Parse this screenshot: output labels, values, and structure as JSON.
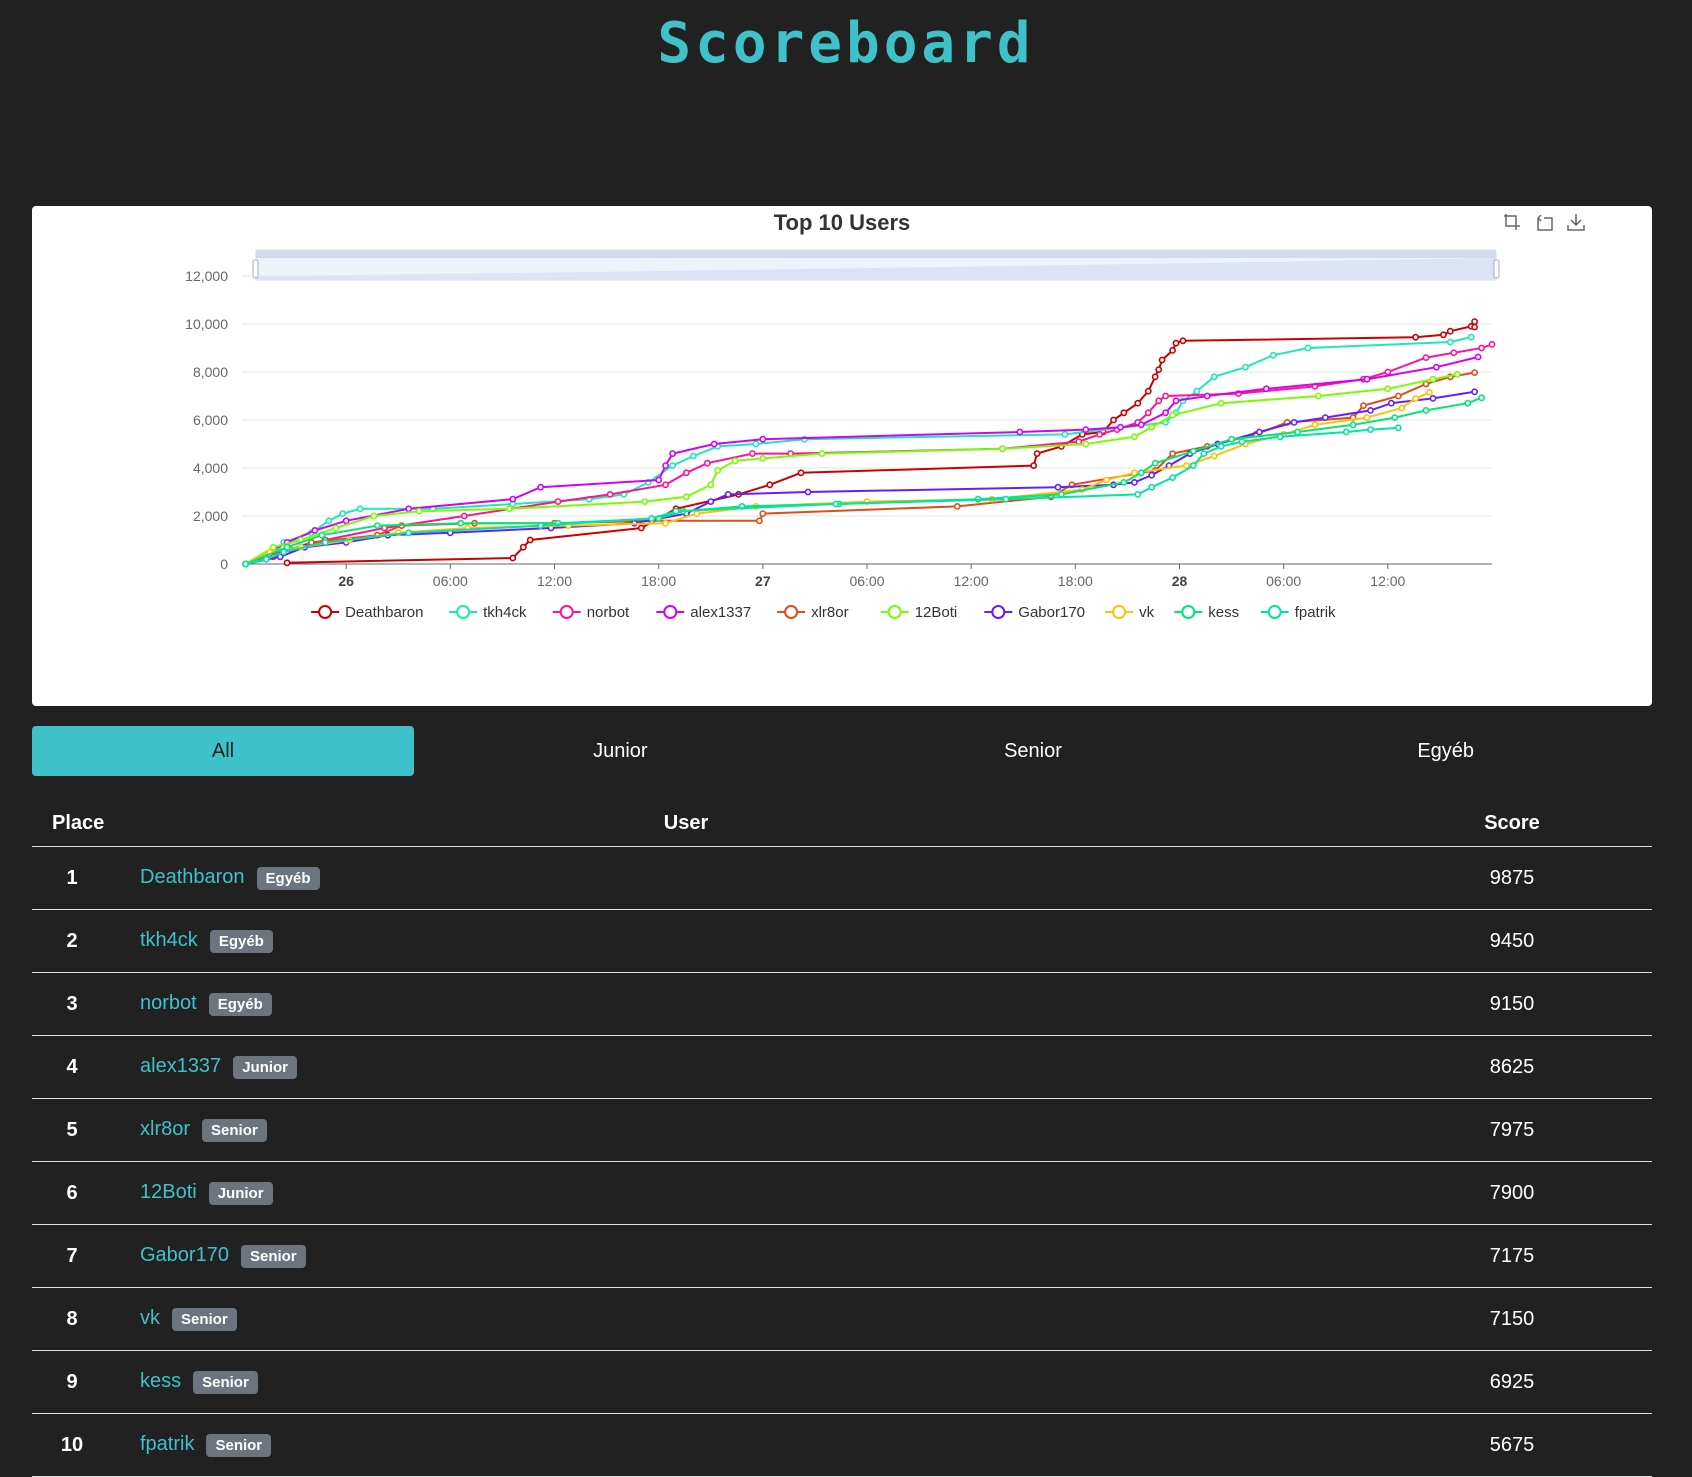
{
  "header": {
    "title": "Scoreboard"
  },
  "toolbox": {
    "zoom_icon": "zoom-icon",
    "restore_icon": "restore-icon",
    "download_icon": "download-icon"
  },
  "tabs": [
    {
      "label": "All",
      "active": true
    },
    {
      "label": "Junior",
      "active": false
    },
    {
      "label": "Senior",
      "active": false
    },
    {
      "label": "Egyéb",
      "active": false
    }
  ],
  "table": {
    "headers": {
      "place": "Place",
      "user": "User",
      "score": "Score"
    },
    "rows": [
      {
        "place": "1",
        "user": "Deathbaron",
        "badge": "Egyéb",
        "score": "9875"
      },
      {
        "place": "2",
        "user": "tkh4ck",
        "badge": "Egyéb",
        "score": "9450"
      },
      {
        "place": "3",
        "user": "norbot",
        "badge": "Egyéb",
        "score": "9150"
      },
      {
        "place": "4",
        "user": "alex1337",
        "badge": "Junior",
        "score": "8625"
      },
      {
        "place": "5",
        "user": "xlr8or",
        "badge": "Senior",
        "score": "7975"
      },
      {
        "place": "6",
        "user": "12Boti",
        "badge": "Junior",
        "score": "7900"
      },
      {
        "place": "7",
        "user": "Gabor170",
        "badge": "Senior",
        "score": "7175"
      },
      {
        "place": "8",
        "user": "vk",
        "badge": "Senior",
        "score": "7150"
      },
      {
        "place": "9",
        "user": "kess",
        "badge": "Senior",
        "score": "6925"
      },
      {
        "place": "10",
        "user": "fpatrik",
        "badge": "Senior",
        "score": "5675"
      }
    ]
  },
  "chart_data": {
    "type": "line",
    "title": "Top 10 Users",
    "ylim": [
      0,
      12000
    ],
    "yticks": [
      "0",
      "2,000",
      "4,000",
      "6,000",
      "8,000",
      "10,000",
      "12,000"
    ],
    "xlim": [
      -1.0,
      71.0
    ],
    "xticks": [
      {
        "label": "26",
        "x": 5,
        "bold": true
      },
      {
        "label": "06:00",
        "x": 11,
        "bold": false
      },
      {
        "label": "12:00",
        "x": 17,
        "bold": false
      },
      {
        "label": "18:00",
        "x": 23,
        "bold": false
      },
      {
        "label": "27",
        "x": 29,
        "bold": true
      },
      {
        "label": "06:00",
        "x": 35,
        "bold": false
      },
      {
        "label": "12:00",
        "x": 41,
        "bold": false
      },
      {
        "label": "18:00",
        "x": 47,
        "bold": false
      },
      {
        "label": "28",
        "x": 53,
        "bold": true
      },
      {
        "label": "06:00",
        "x": 59,
        "bold": false
      },
      {
        "label": "12:00",
        "x": 65,
        "bold": false
      }
    ],
    "grid": true,
    "legend_position": "bottom",
    "datazoom_slider": true,
    "series": [
      {
        "name": "Deathbaron",
        "color": "#cc0000",
        "points": [
          [
            1.6,
            50
          ],
          [
            14.6,
            250
          ],
          [
            15.2,
            700
          ],
          [
            15.6,
            1000
          ],
          [
            22.0,
            1500
          ],
          [
            24.0,
            2300
          ],
          [
            27.6,
            2900
          ],
          [
            29.4,
            3300
          ],
          [
            31.2,
            3800
          ],
          [
            44.6,
            4100
          ],
          [
            44.8,
            4600
          ],
          [
            46.2,
            4900
          ],
          [
            47.4,
            5400
          ],
          [
            48.6,
            5500
          ],
          [
            49.2,
            6000
          ],
          [
            49.8,
            6300
          ],
          [
            50.6,
            6700
          ],
          [
            51.2,
            7200
          ],
          [
            51.6,
            7800
          ],
          [
            51.8,
            8100
          ],
          [
            52.0,
            8500
          ],
          [
            52.6,
            8900
          ],
          [
            52.8,
            9200
          ],
          [
            53.2,
            9300
          ],
          [
            66.6,
            9450
          ],
          [
            68.2,
            9550
          ],
          [
            68.6,
            9700
          ],
          [
            69.8,
            9900
          ],
          [
            70.0,
            10100
          ],
          [
            70.0,
            9875
          ]
        ]
      },
      {
        "name": "tkh4ck",
        "color": "#1de9b6",
        "points": [
          [
            -0.8,
            0
          ],
          [
            0.4,
            200
          ],
          [
            1.0,
            500
          ],
          [
            1.4,
            900
          ],
          [
            3.0,
            1300
          ],
          [
            4.0,
            1800
          ],
          [
            4.8,
            2100
          ],
          [
            5.8,
            2300
          ],
          [
            10.0,
            2300
          ],
          [
            14.6,
            2500
          ],
          [
            19.0,
            2700
          ],
          [
            21.0,
            2900
          ],
          [
            22.4,
            3400
          ],
          [
            23.8,
            4100
          ],
          [
            25.0,
            4500
          ],
          [
            26.4,
            4900
          ],
          [
            28.6,
            5000
          ],
          [
            31.4,
            5200
          ],
          [
            46.4,
            5400
          ],
          [
            52.2,
            5900
          ],
          [
            52.8,
            6300
          ],
          [
            53.2,
            6800
          ],
          [
            54.0,
            7200
          ],
          [
            55.0,
            7800
          ],
          [
            56.8,
            8200
          ],
          [
            58.4,
            8700
          ],
          [
            60.4,
            9000
          ],
          [
            68.6,
            9250
          ],
          [
            69.8,
            9450
          ]
        ]
      },
      {
        "name": "norbot",
        "color": "#ff1493",
        "points": [
          [
            -0.8,
            0
          ],
          [
            0.6,
            400
          ],
          [
            3.8,
            1000
          ],
          [
            7.2,
            1500
          ],
          [
            11.8,
            2000
          ],
          [
            17.2,
            2600
          ],
          [
            20.2,
            2900
          ],
          [
            23.4,
            3300
          ],
          [
            24.6,
            3800
          ],
          [
            25.8,
            4200
          ],
          [
            28.4,
            4600
          ],
          [
            30.6,
            4600
          ],
          [
            42.8,
            4800
          ],
          [
            47.2,
            5100
          ],
          [
            48.4,
            5400
          ],
          [
            49.4,
            5600
          ],
          [
            50.6,
            5900
          ],
          [
            51.2,
            6300
          ],
          [
            51.8,
            6800
          ],
          [
            52.2,
            7000
          ],
          [
            56.4,
            7100
          ],
          [
            60.8,
            7400
          ],
          [
            63.6,
            7700
          ],
          [
            65.0,
            8000
          ],
          [
            67.2,
            8600
          ],
          [
            68.8,
            8800
          ],
          [
            70.4,
            9000
          ],
          [
            71.0,
            9150
          ]
        ]
      },
      {
        "name": "alex1337",
        "color": "#d500f9",
        "points": [
          [
            -0.8,
            0
          ],
          [
            1.6,
            900
          ],
          [
            3.2,
            1400
          ],
          [
            5.0,
            1800
          ],
          [
            8.6,
            2300
          ],
          [
            14.6,
            2700
          ],
          [
            16.2,
            3200
          ],
          [
            23.0,
            3500
          ],
          [
            23.4,
            4100
          ],
          [
            23.8,
            4600
          ],
          [
            26.2,
            5000
          ],
          [
            29.0,
            5200
          ],
          [
            43.8,
            5500
          ],
          [
            47.6,
            5600
          ],
          [
            49.6,
            5700
          ],
          [
            50.8,
            5800
          ],
          [
            52.2,
            6300
          ],
          [
            52.8,
            6800
          ],
          [
            54.6,
            7000
          ],
          [
            58.0,
            7300
          ],
          [
            63.8,
            7700
          ],
          [
            67.8,
            8200
          ],
          [
            70.2,
            8625
          ]
        ]
      },
      {
        "name": "xlr8or",
        "color": "#e64a19",
        "points": [
          [
            -0.8,
            0
          ],
          [
            0.8,
            300
          ],
          [
            1.8,
            600
          ],
          [
            3.0,
            900
          ],
          [
            6.8,
            1200
          ],
          [
            8.2,
            1600
          ],
          [
            12.4,
            1700
          ],
          [
            17.0,
            1700
          ],
          [
            22.6,
            1800
          ],
          [
            28.8,
            1800
          ],
          [
            29.0,
            2100
          ],
          [
            40.2,
            2400
          ],
          [
            45.6,
            2800
          ],
          [
            46.8,
            3300
          ],
          [
            51.6,
            3900
          ],
          [
            52.6,
            4600
          ],
          [
            54.6,
            4900
          ],
          [
            57.4,
            5400
          ],
          [
            59.2,
            5900
          ],
          [
            63.0,
            6100
          ],
          [
            63.6,
            6600
          ],
          [
            65.6,
            7000
          ],
          [
            67.2,
            7500
          ],
          [
            68.6,
            7800
          ],
          [
            70.0,
            7975
          ]
        ]
      },
      {
        "name": "12Boti",
        "color": "#76ff03",
        "points": [
          [
            -0.8,
            0
          ],
          [
            0.8,
            700
          ],
          [
            2.4,
            1000
          ],
          [
            4.4,
            1500
          ],
          [
            6.6,
            2000
          ],
          [
            9.2,
            2200
          ],
          [
            14.4,
            2300
          ],
          [
            22.2,
            2600
          ],
          [
            24.6,
            2800
          ],
          [
            26.0,
            3300
          ],
          [
            26.4,
            3900
          ],
          [
            27.4,
            4300
          ],
          [
            29.0,
            4400
          ],
          [
            32.4,
            4600
          ],
          [
            42.8,
            4800
          ],
          [
            47.6,
            5000
          ],
          [
            50.4,
            5300
          ],
          [
            51.4,
            5700
          ],
          [
            52.6,
            6200
          ],
          [
            55.4,
            6700
          ],
          [
            61.0,
            7000
          ],
          [
            65.0,
            7300
          ],
          [
            67.6,
            7700
          ],
          [
            69.0,
            7900
          ]
        ]
      },
      {
        "name": "Gabor170",
        "color": "#651fff",
        "points": [
          [
            -0.8,
            0
          ],
          [
            1.2,
            300
          ],
          [
            2.6,
            700
          ],
          [
            5.0,
            900
          ],
          [
            7.4,
            1200
          ],
          [
            11.0,
            1300
          ],
          [
            16.8,
            1500
          ],
          [
            21.6,
            1700
          ],
          [
            24.6,
            2100
          ],
          [
            26.0,
            2600
          ],
          [
            27.0,
            2900
          ],
          [
            31.6,
            3000
          ],
          [
            46.0,
            3200
          ],
          [
            49.2,
            3300
          ],
          [
            50.4,
            3400
          ],
          [
            51.4,
            3700
          ],
          [
            52.4,
            4100
          ],
          [
            53.6,
            4600
          ],
          [
            55.2,
            5000
          ],
          [
            57.6,
            5500
          ],
          [
            59.6,
            5900
          ],
          [
            61.4,
            6100
          ],
          [
            64.0,
            6400
          ],
          [
            65.2,
            6700
          ],
          [
            67.6,
            6900
          ],
          [
            70.0,
            7175
          ]
        ]
      },
      {
        "name": "vk",
        "color": "#ffc107",
        "points": [
          [
            -0.8,
            0
          ],
          [
            0.6,
            500
          ],
          [
            2.4,
            700
          ],
          [
            5.2,
            1000
          ],
          [
            8.0,
            1300
          ],
          [
            12.0,
            1500
          ],
          [
            17.8,
            1600
          ],
          [
            23.4,
            1700
          ],
          [
            25.2,
            2100
          ],
          [
            28.6,
            2400
          ],
          [
            35.0,
            2600
          ],
          [
            42.2,
            2700
          ],
          [
            47.4,
            3100
          ],
          [
            48.8,
            3500
          ],
          [
            50.4,
            3800
          ],
          [
            53.4,
            4100
          ],
          [
            55.0,
            4500
          ],
          [
            56.8,
            5000
          ],
          [
            59.0,
            5400
          ],
          [
            60.8,
            5800
          ],
          [
            63.8,
            6100
          ],
          [
            65.8,
            6500
          ],
          [
            66.6,
            6900
          ],
          [
            67.4,
            7150
          ]
        ]
      },
      {
        "name": "kess",
        "color": "#00e676",
        "points": [
          [
            -0.8,
            0
          ],
          [
            1.6,
            700
          ],
          [
            3.6,
            1200
          ],
          [
            6.8,
            1600
          ],
          [
            11.6,
            1700
          ],
          [
            17.2,
            1700
          ],
          [
            23.0,
            1900
          ],
          [
            24.4,
            2200
          ],
          [
            27.8,
            2400
          ],
          [
            33.4,
            2500
          ],
          [
            41.4,
            2700
          ],
          [
            46.2,
            2900
          ],
          [
            49.8,
            3400
          ],
          [
            50.8,
            3800
          ],
          [
            51.6,
            4200
          ],
          [
            53.8,
            4700
          ],
          [
            56.0,
            5200
          ],
          [
            59.8,
            5500
          ],
          [
            63.0,
            5800
          ],
          [
            65.4,
            6100
          ],
          [
            67.2,
            6400
          ],
          [
            69.6,
            6700
          ],
          [
            70.4,
            6925
          ]
        ]
      },
      {
        "name": "fpatrik",
        "color": "#00e5a0",
        "points": [
          [
            -0.8,
            0
          ],
          [
            0.4,
            200
          ],
          [
            1.4,
            500
          ],
          [
            3.8,
            900
          ],
          [
            8.6,
            1300
          ],
          [
            16.2,
            1600
          ],
          [
            22.6,
            1900
          ],
          [
            24.0,
            2200
          ],
          [
            33.2,
            2500
          ],
          [
            43.0,
            2700
          ],
          [
            50.6,
            2900
          ],
          [
            51.4,
            3200
          ],
          [
            52.6,
            3600
          ],
          [
            53.8,
            4100
          ],
          [
            54.4,
            4600
          ],
          [
            55.4,
            4900
          ],
          [
            56.6,
            5100
          ],
          [
            58.8,
            5300
          ],
          [
            62.6,
            5500
          ],
          [
            64.0,
            5600
          ],
          [
            65.6,
            5675
          ]
        ]
      }
    ]
  }
}
